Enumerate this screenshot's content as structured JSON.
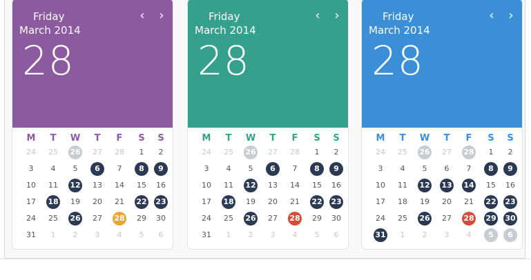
{
  "cards": [
    {
      "theme_color": "#8c5a9e",
      "weekday_color": "#8c5a9e",
      "day_name": "Friday",
      "month_year": "March 2014",
      "big_day": "28",
      "prev_label": "‹",
      "next_label": "›",
      "weekdays": [
        "M",
        "T",
        "W",
        "T",
        "F",
        "S",
        "S"
      ],
      "days": [
        [
          "24",
          "muted",
          ""
        ],
        [
          "25",
          "muted",
          ""
        ],
        [
          "26",
          "muted",
          "gray"
        ],
        [
          "27",
          "muted",
          ""
        ],
        [
          "28",
          "muted",
          ""
        ],
        [
          "1",
          "",
          ""
        ],
        [
          "2",
          "",
          ""
        ],
        [
          "3",
          "",
          ""
        ],
        [
          "4",
          "",
          ""
        ],
        [
          "5",
          "",
          ""
        ],
        [
          "6",
          "",
          "navy"
        ],
        [
          "7",
          "",
          ""
        ],
        [
          "8",
          "",
          "navy"
        ],
        [
          "9",
          "",
          "navy"
        ],
        [
          "10",
          "",
          ""
        ],
        [
          "11",
          "",
          ""
        ],
        [
          "12",
          "",
          "navy"
        ],
        [
          "13",
          "",
          ""
        ],
        [
          "14",
          "",
          ""
        ],
        [
          "15",
          "",
          ""
        ],
        [
          "16",
          "",
          ""
        ],
        [
          "17",
          "",
          ""
        ],
        [
          "18",
          "",
          "navy"
        ],
        [
          "19",
          "",
          ""
        ],
        [
          "20",
          "",
          ""
        ],
        [
          "21",
          "",
          ""
        ],
        [
          "22",
          "",
          "navy"
        ],
        [
          "23",
          "",
          "navy"
        ],
        [
          "24",
          "",
          ""
        ],
        [
          "25",
          "",
          ""
        ],
        [
          "26",
          "",
          "navy"
        ],
        [
          "27",
          "",
          ""
        ],
        [
          "28",
          "",
          "orange"
        ],
        [
          "29",
          "",
          ""
        ],
        [
          "30",
          "",
          ""
        ],
        [
          "31",
          "",
          ""
        ],
        [
          "1",
          "muted",
          ""
        ],
        [
          "2",
          "muted",
          ""
        ],
        [
          "3",
          "muted",
          ""
        ],
        [
          "4",
          "muted",
          ""
        ],
        [
          "5",
          "muted",
          ""
        ],
        [
          "6",
          "muted",
          ""
        ]
      ]
    },
    {
      "theme_color": "#35a08c",
      "weekday_color": "#35a08c",
      "day_name": "Friday",
      "month_year": "March 2014",
      "big_day": "28",
      "prev_label": "‹",
      "next_label": "›",
      "weekdays": [
        "M",
        "T",
        "W",
        "T",
        "F",
        "S",
        "S"
      ],
      "days": [
        [
          "24",
          "muted",
          ""
        ],
        [
          "25",
          "muted",
          ""
        ],
        [
          "26",
          "muted",
          "gray"
        ],
        [
          "27",
          "muted",
          ""
        ],
        [
          "28",
          "muted",
          ""
        ],
        [
          "1",
          "",
          ""
        ],
        [
          "2",
          "",
          ""
        ],
        [
          "3",
          "",
          ""
        ],
        [
          "4",
          "",
          ""
        ],
        [
          "5",
          "",
          ""
        ],
        [
          "6",
          "",
          "navy"
        ],
        [
          "7",
          "",
          ""
        ],
        [
          "8",
          "",
          "navy"
        ],
        [
          "9",
          "",
          "navy"
        ],
        [
          "10",
          "",
          ""
        ],
        [
          "11",
          "",
          ""
        ],
        [
          "12",
          "",
          "navy"
        ],
        [
          "13",
          "",
          ""
        ],
        [
          "14",
          "",
          ""
        ],
        [
          "15",
          "",
          ""
        ],
        [
          "16",
          "",
          ""
        ],
        [
          "17",
          "",
          ""
        ],
        [
          "18",
          "",
          "navy"
        ],
        [
          "19",
          "",
          ""
        ],
        [
          "20",
          "",
          ""
        ],
        [
          "21",
          "",
          ""
        ],
        [
          "22",
          "",
          "navy"
        ],
        [
          "23",
          "",
          "navy"
        ],
        [
          "24",
          "",
          ""
        ],
        [
          "25",
          "",
          ""
        ],
        [
          "26",
          "",
          "navy"
        ],
        [
          "27",
          "",
          ""
        ],
        [
          "28",
          "",
          "red"
        ],
        [
          "29",
          "",
          ""
        ],
        [
          "30",
          "",
          ""
        ],
        [
          "31",
          "",
          ""
        ],
        [
          "1",
          "muted",
          ""
        ],
        [
          "2",
          "muted",
          ""
        ],
        [
          "3",
          "muted",
          ""
        ],
        [
          "4",
          "muted",
          ""
        ],
        [
          "5",
          "muted",
          ""
        ],
        [
          "6",
          "muted",
          ""
        ]
      ]
    },
    {
      "theme_color": "#3a8fd6",
      "weekday_color": "#3a8fd6",
      "day_name": "Friday",
      "month_year": "March 2014",
      "big_day": "28",
      "prev_label": "‹",
      "next_label": "›",
      "weekdays": [
        "M",
        "T",
        "W",
        "T",
        "F",
        "S",
        "S"
      ],
      "days": [
        [
          "24",
          "muted",
          ""
        ],
        [
          "25",
          "muted",
          ""
        ],
        [
          "26",
          "muted",
          "gray"
        ],
        [
          "27",
          "muted",
          ""
        ],
        [
          "28",
          "muted",
          "gray"
        ],
        [
          "1",
          "",
          ""
        ],
        [
          "2",
          "",
          ""
        ],
        [
          "3",
          "",
          ""
        ],
        [
          "4",
          "",
          ""
        ],
        [
          "5",
          "",
          ""
        ],
        [
          "6",
          "",
          ""
        ],
        [
          "7",
          "",
          ""
        ],
        [
          "8",
          "",
          "navy"
        ],
        [
          "9",
          "",
          "navy"
        ],
        [
          "10",
          "",
          ""
        ],
        [
          "11",
          "",
          ""
        ],
        [
          "12",
          "",
          "navy"
        ],
        [
          "13",
          "",
          "navy"
        ],
        [
          "14",
          "",
          "navy"
        ],
        [
          "15",
          "",
          ""
        ],
        [
          "16",
          "",
          ""
        ],
        [
          "17",
          "",
          ""
        ],
        [
          "18",
          "",
          ""
        ],
        [
          "19",
          "",
          ""
        ],
        [
          "20",
          "",
          ""
        ],
        [
          "21",
          "",
          ""
        ],
        [
          "22",
          "",
          "navy"
        ],
        [
          "23",
          "",
          "navy"
        ],
        [
          "24",
          "",
          ""
        ],
        [
          "25",
          "",
          ""
        ],
        [
          "26",
          "",
          "navy"
        ],
        [
          "27",
          "",
          ""
        ],
        [
          "28",
          "",
          "red"
        ],
        [
          "29",
          "",
          "navy"
        ],
        [
          "30",
          "",
          "navy"
        ],
        [
          "31",
          "",
          "navy"
        ],
        [
          "1",
          "muted",
          ""
        ],
        [
          "2",
          "muted",
          ""
        ],
        [
          "3",
          "muted",
          ""
        ],
        [
          "4",
          "muted",
          ""
        ],
        [
          "5",
          "muted",
          "gray"
        ],
        [
          "6",
          "muted",
          "gray"
        ]
      ]
    }
  ]
}
